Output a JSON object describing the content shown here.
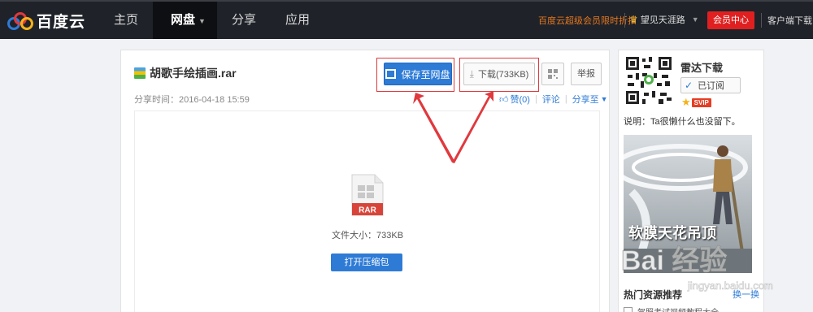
{
  "header": {
    "logo_text": "百度云",
    "nav": [
      {
        "label": "主页"
      },
      {
        "label": "网盘"
      },
      {
        "label": "分享"
      },
      {
        "label": "应用"
      }
    ],
    "promo": "百度云超级会员限时折扣",
    "username": "望见天涯路",
    "vip_center": "会员中心",
    "client_download": "客户端下载"
  },
  "file": {
    "name": "胡歌手绘插画.rar",
    "share_time": "分享时间：2016-04-18 15:59",
    "save_label": "保存至网盘",
    "download_label": "下载(733KB)",
    "report_label": "举报",
    "like_label": "赞(0)",
    "comment_label": "评论",
    "share_to_label": "分享至",
    "type_label": "RAR",
    "size_text": "文件大小：733KB",
    "open_label": "打开压缩包"
  },
  "sidebar": {
    "owner": "雷达下载",
    "subscribed_label": "已订阅",
    "svip_badge": "SVIP",
    "description": "说明：Ta很懒什么也没留下。",
    "ad_caption": "软膜天花吊顶",
    "hot_title": "热门资源推荐",
    "refresh_label": "换一换",
    "hot_items": [
      {
        "label": "驾照考试视频教程大全"
      }
    ]
  },
  "watermark": {
    "brand": "Bai 经验",
    "url": "jingyan.baidu.com"
  },
  "colors": {
    "nav_bg": "#1f2229",
    "primary": "#2e7bd6",
    "highlight": "#e0393e",
    "promo": "#e6781e",
    "vip": "#e02020"
  }
}
